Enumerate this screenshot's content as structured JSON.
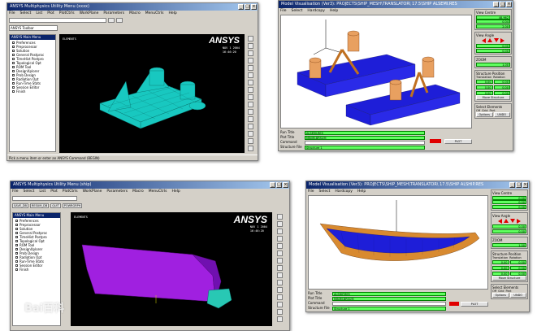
{
  "win_tl": {
    "title": "ANSYS Multiphysics Utility Menu (xxxx)",
    "menu": [
      "File",
      "Select",
      "List",
      "Plot",
      "PlotCtrls",
      "WorkPlane",
      "Parameters",
      "Macro",
      "MenuCtrls",
      "Help"
    ],
    "toolbar_label": "ANSYS Toolbar",
    "main_menu_title": "ANSYS Main Menu",
    "main_menu": [
      "Preferences",
      "Preprocessor",
      "Solution",
      "General Postproc",
      "TimeHist Postpro",
      "Topological Opt",
      "ROM Tool",
      "DesignXplorer",
      "Prob Design",
      "Radiation Opt",
      "Run-Time Stats",
      "Session Editor",
      "Finish"
    ],
    "gfx_label": "ELEMENTS",
    "gfx_info": "NOV 1 2004\n16:46:20",
    "logo": "ANSYS",
    "status": "Pick a menu item or enter an ANSYS Command (BEGIN)"
  },
  "win_tr": {
    "title": "Model Visualisation (Ver3): PROJECTS\\SHIP_MESH\\TRANSLATOR\\ 17.5\\SHIP ALSEMI.RES",
    "menu": [
      "File",
      "Select",
      "Hardcopy",
      "Help"
    ],
    "view_centre": "View Centre",
    "vc_values": [
      "48.962",
      "0.04",
      "2.00"
    ],
    "view_angle": "View Angle",
    "va_values": [
      "0.00",
      "0.00"
    ],
    "zoom": "ZOOM",
    "zoom_value": "1.00",
    "struct_pos": "Structure Position",
    "translation": "Translation",
    "rotation": "Rotation",
    "sp_values": [
      "0.00",
      "0.00",
      "0.00",
      "0.00",
      "0.00",
      "0.00"
    ],
    "move_structure": "Move Structure",
    "select_elements": "Select Elements",
    "radio": [
      "Off",
      "Grid",
      "Part"
    ],
    "options_btn": "Options",
    "undo_btn": "UNDO",
    "info": [
      {
        "k": "Run Title",
        "v": "ALSEMI.RES"
      },
      {
        "k": "Plot Title",
        "v": "MINIM.BRSUM"
      },
      {
        "k": "Command",
        "v": ""
      },
      {
        "k": "Structure File",
        "v": "Structure 1"
      }
    ],
    "plot_btn": "PLOT"
  },
  "win_bl": {
    "title": "ANSYS Multiphysics Utility Menu (ship)",
    "menu": [
      "File",
      "Select",
      "List",
      "Plot",
      "PlotCtrls",
      "WorkPlane",
      "Parameters",
      "Macro",
      "MenuCtrls",
      "Help"
    ],
    "toolbar_buttons": [
      "SAVE_DB",
      "RESUM_DB",
      "QUIT",
      "POWRGRPH"
    ],
    "main_menu_title": "ANSYS Main Menu",
    "main_menu": [
      "Preferences",
      "Preprocessor",
      "Solution",
      "General Postproc",
      "TimeHist Postpro",
      "Topological Opt",
      "ROM Tool",
      "DesignXplorer",
      "Prob Design",
      "Radiation Opt",
      "Run-Time Stats",
      "Session Editor",
      "Finish"
    ],
    "gfx_label": "ELEMENTS",
    "gfx_info": "NOV 1 2004\n16:46:20",
    "logo": "ANSYS"
  },
  "win_br": {
    "title": "Model Visualisation (Ver3): PROJECTS\\SHIP_MESH\\TRANSLATOR\\ 17.5\\SHIP ALSHIP.RES",
    "menu": [
      "File",
      "Select",
      "Hardcopy",
      "Help"
    ],
    "view_centre": "View Centre",
    "vc_values": [
      "0.00",
      "0.00",
      "0.00"
    ],
    "view_angle": "View Angle",
    "va_values": [
      "0.00",
      "0.00"
    ],
    "zoom": "ZOOM",
    "zoom_value": "1.00",
    "struct_pos": "Structure Position",
    "translation": "Translation",
    "rotation": "Rotation",
    "sp_values": [
      "0.00",
      "0.00",
      "0.00",
      "0.00",
      "0.00",
      "0.00"
    ],
    "move_structure": "Move Structure",
    "select_elements": "Select Elements",
    "radio": [
      "Off",
      "Grid",
      "Part"
    ],
    "options_btn": "Options",
    "undo_btn": "UNDO",
    "info": [
      {
        "k": "Run Title",
        "v": "ALSHIP.RES"
      },
      {
        "k": "Plot Title",
        "v": "MINIM.BRSUM"
      },
      {
        "k": "Command",
        "v": ""
      },
      {
        "k": "Structure File",
        "v": "Structure 1"
      }
    ],
    "plot_btn": "PLOT"
  },
  "watermark": "Bai百科"
}
